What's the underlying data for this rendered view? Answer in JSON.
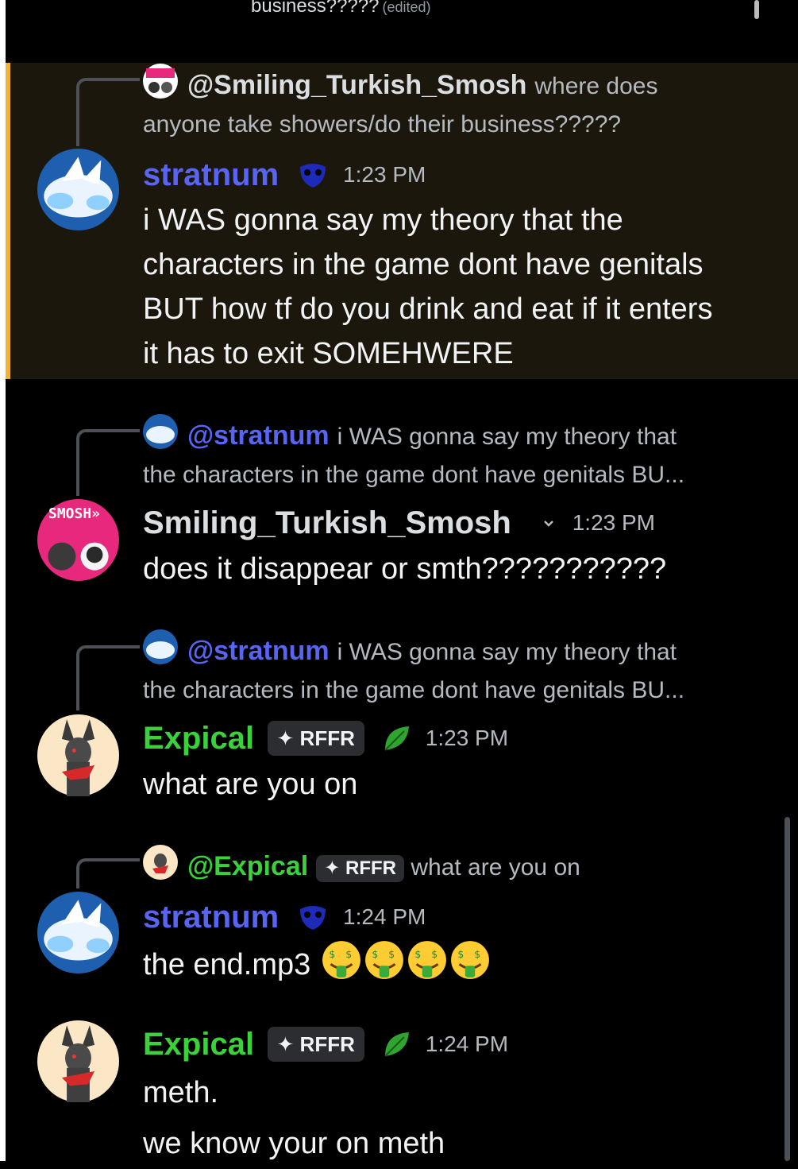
{
  "top": {
    "snippet": "business?????",
    "edited": "(edited)"
  },
  "colors": {
    "highlight_bg": "#1c170d",
    "highlight_bar": "#f0b232",
    "blue_user": "#5865f2",
    "green_user": "#3ad13a"
  },
  "messages": [
    {
      "reply": {
        "mention": "@Smiling_Turkish_Smosh",
        "preview_1": "where does",
        "preview_2": "anyone take showers/do their business?????"
      },
      "username": "stratnum",
      "time": "1:23 PM",
      "icon": "blue-mask-decoration-icon",
      "text": [
        "i WAS gonna say my theory that the",
        "characters in the game dont have genitals",
        "BUT how tf do you drink and eat if it enters",
        "it has to exit SOMEHWERE"
      ]
    },
    {
      "reply": {
        "mention": "@stratnum",
        "preview_1": "i WAS gonna say my theory that",
        "preview_2": "the characters in the game dont have genitals BU..."
      },
      "username": "Smiling_Turkish_Smosh",
      "time": "1:23 PM",
      "icon": "chevron-down-icon",
      "avatar_text": "SMOSH»",
      "text": [
        "does it disappear or smth???????????"
      ]
    },
    {
      "reply": {
        "mention": "@stratnum",
        "preview_1": "i WAS gonna say my theory that",
        "preview_2": "the characters in the game dont have genitals BU..."
      },
      "username": "Expical",
      "tag": "RFFR",
      "time": "1:23 PM",
      "icon": "leaf-icon",
      "text": [
        "what are you on"
      ]
    },
    {
      "reply": {
        "mention": "@Expical",
        "tag": "RFFR",
        "preview_1": "what are you on"
      },
      "username": "stratnum",
      "time": "1:24 PM",
      "icon": "blue-mask-decoration-icon",
      "text": [
        "the end.mp3"
      ],
      "emoji_count": 4,
      "emoji_name": "money-mouth-face-emoji"
    },
    {
      "username": "Expical",
      "tag": "RFFR",
      "time": "1:24 PM",
      "icon": "leaf-icon",
      "text": [
        "meth.",
        "we know your on meth"
      ]
    }
  ]
}
